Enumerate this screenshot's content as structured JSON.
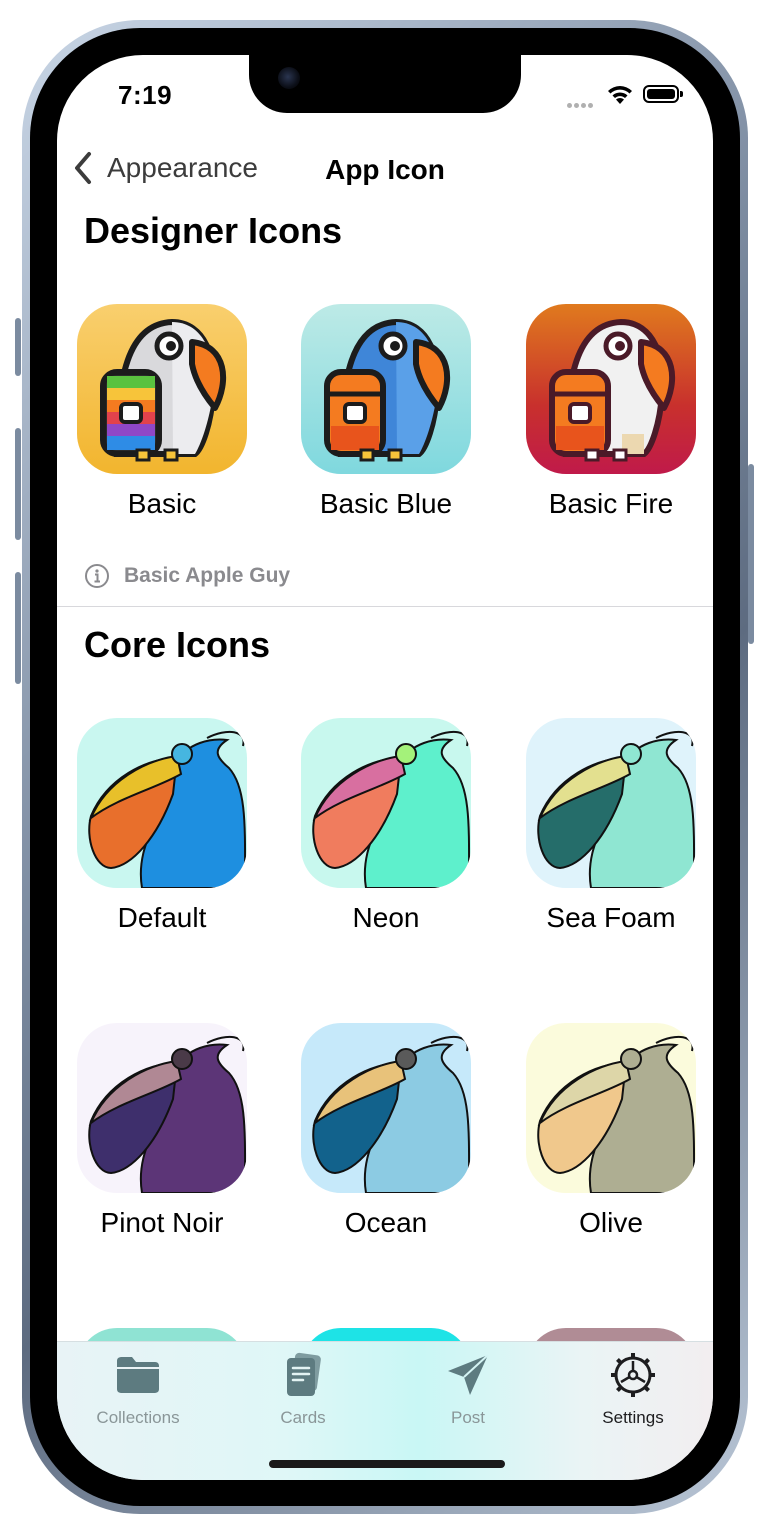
{
  "status_bar": {
    "time": "7:19"
  },
  "nav": {
    "back_label": "Appearance",
    "title": "App Icon"
  },
  "designer_section": {
    "title": "Designer Icons",
    "icons": [
      {
        "label": "Basic",
        "icon": "basic-bird-icon"
      },
      {
        "label": "Basic Blue",
        "icon": "basic-blue-bird-icon"
      },
      {
        "label": "Basic Fire",
        "icon": "basic-fire-bird-icon"
      }
    ],
    "footer": "Basic Apple Guy"
  },
  "core_section": {
    "title": "Core Icons",
    "icons": [
      {
        "label": "Default",
        "icon": "pelican-default-icon"
      },
      {
        "label": "Neon",
        "icon": "pelican-neon-icon"
      },
      {
        "label": "Sea Foam",
        "icon": "pelican-sea-foam-icon"
      },
      {
        "label": "Pinot Noir",
        "icon": "pelican-pinot-noir-icon"
      },
      {
        "label": "Ocean",
        "icon": "pelican-ocean-icon"
      },
      {
        "label": "Olive",
        "icon": "pelican-olive-icon"
      }
    ]
  },
  "tabs": [
    {
      "label": "Collections",
      "icon": "folder-icon"
    },
    {
      "label": "Cards",
      "icon": "cards-icon"
    },
    {
      "label": "Post",
      "icon": "paper-plane-icon"
    },
    {
      "label": "Settings",
      "icon": "gear-icon",
      "active": true
    }
  ],
  "colors": {
    "text_primary": "#000000",
    "text_secondary": "#8a8a8e",
    "tab_inactive": "#8a9698",
    "tab_icon": "#5d7b80"
  }
}
